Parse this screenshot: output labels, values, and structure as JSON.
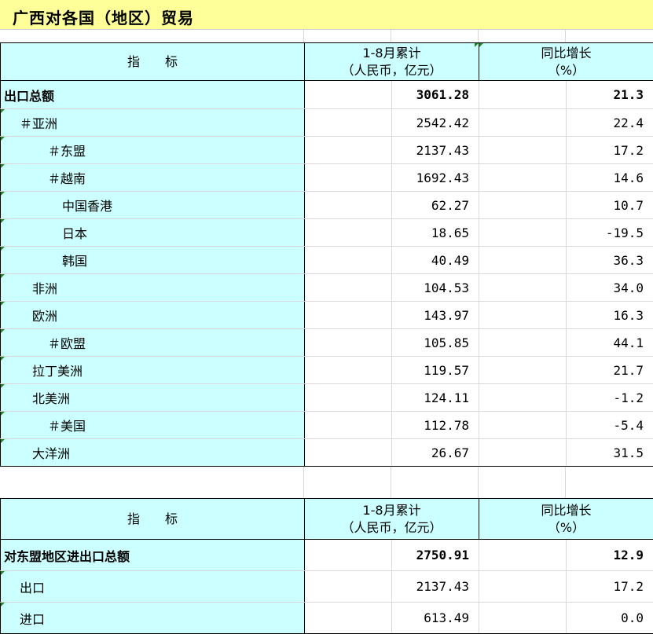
{
  "title": "广西对各国（地区）贸易",
  "header": {
    "indicator": "指　　标",
    "col1_line1": "1-8月累计",
    "col1_line2": "（人民币，亿元）",
    "col2_line1": "同比增长",
    "col2_line2": "（%）"
  },
  "table1": {
    "rows": [
      {
        "label": "出口总额",
        "value": "3061.28",
        "growth": "21.3",
        "bold": true,
        "indent": 0
      },
      {
        "label": "＃亚洲",
        "value": "2542.42",
        "growth": "22.4",
        "indent": 1
      },
      {
        "label": "＃东盟",
        "value": "2137.43",
        "growth": "17.2",
        "indent": 3
      },
      {
        "label": "＃越南",
        "value": "1692.43",
        "growth": "14.6",
        "indent": 3
      },
      {
        "label": "中国香港",
        "value": "62.27",
        "growth": "10.7",
        "indent": 4
      },
      {
        "label": "日本",
        "value": "18.65",
        "growth": "-19.5",
        "indent": 4
      },
      {
        "label": "韩国",
        "value": "40.49",
        "growth": "36.3",
        "indent": 4
      },
      {
        "label": "非洲",
        "value": "104.53",
        "growth": "34.0",
        "indent": 2
      },
      {
        "label": "欧洲",
        "value": "143.97",
        "growth": "16.3",
        "indent": 2
      },
      {
        "label": "＃欧盟",
        "value": "105.85",
        "growth": "44.1",
        "indent": 3
      },
      {
        "label": "拉丁美洲",
        "value": "119.57",
        "growth": "21.7",
        "indent": 2
      },
      {
        "label": "北美洲",
        "value": "124.11",
        "growth": "-1.2",
        "indent": 2
      },
      {
        "label": "＃美国",
        "value": "112.78",
        "growth": "-5.4",
        "indent": 3
      },
      {
        "label": "大洋洲",
        "value": "26.67",
        "growth": "31.5",
        "indent": 2
      }
    ]
  },
  "table2": {
    "rows": [
      {
        "label": "对东盟地区进出口总额",
        "value": "2750.91",
        "growth": "12.9",
        "bold": true,
        "indent": 0
      },
      {
        "label": "出口",
        "value": "2137.43",
        "growth": "17.2",
        "indent": 1
      },
      {
        "label": "进口",
        "value": "613.49",
        "growth": "0.0",
        "indent": 1
      }
    ]
  }
}
